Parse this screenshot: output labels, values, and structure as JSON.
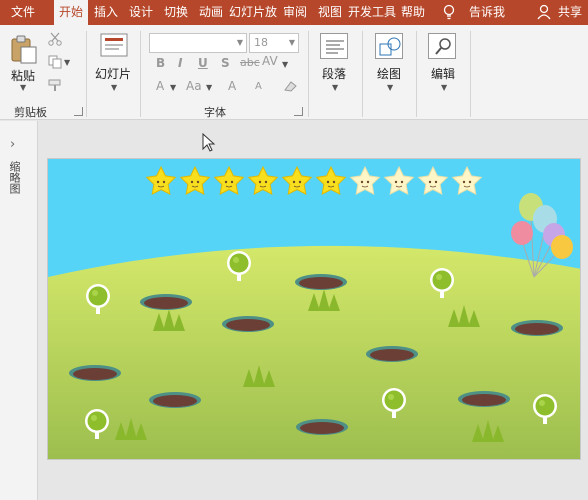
{
  "tabs": {
    "items": [
      {
        "label": "文件",
        "active": false
      },
      {
        "label": "开始",
        "active": true
      },
      {
        "label": "插入",
        "active": false
      },
      {
        "label": "设计",
        "active": false
      },
      {
        "label": "切换",
        "active": false
      },
      {
        "label": "动画",
        "active": false
      },
      {
        "label": "幻灯片放",
        "active": false
      },
      {
        "label": "审阅",
        "active": false
      },
      {
        "label": "视图",
        "active": false
      },
      {
        "label": "开发工具",
        "active": false
      },
      {
        "label": "帮助",
        "active": false
      }
    ],
    "tell_me": "告诉我",
    "share": "共享"
  },
  "ribbon": {
    "clipboard": {
      "paste_label": "粘贴",
      "group_label": "剪贴板"
    },
    "slides": {
      "new_slide_label": "幻灯片"
    },
    "font": {
      "font_name": "",
      "font_size": "18",
      "group_label": "字体",
      "bold": "B",
      "italic": "I",
      "underline": "U",
      "shadow": "S",
      "strike": "abc",
      "spacing": "AV",
      "color": "A",
      "case": "Aa",
      "grow": "A",
      "shrink": "A"
    },
    "paragraph": {
      "label": "段落"
    },
    "drawing": {
      "label": "绘图"
    },
    "editing": {
      "label": "编辑"
    }
  },
  "rail": {
    "label": "缩略图"
  },
  "slide": {
    "stars_total": 10,
    "stars_filled": 6,
    "colors": {
      "sky": "#55d4f8",
      "hill_top": "#d4e86a",
      "hill_bottom": "#9cbe4e",
      "hole": "#6b3f36",
      "hole_rim": "#4e8f86",
      "tree": "#8fbe2c",
      "accent": "#b7472a"
    }
  }
}
